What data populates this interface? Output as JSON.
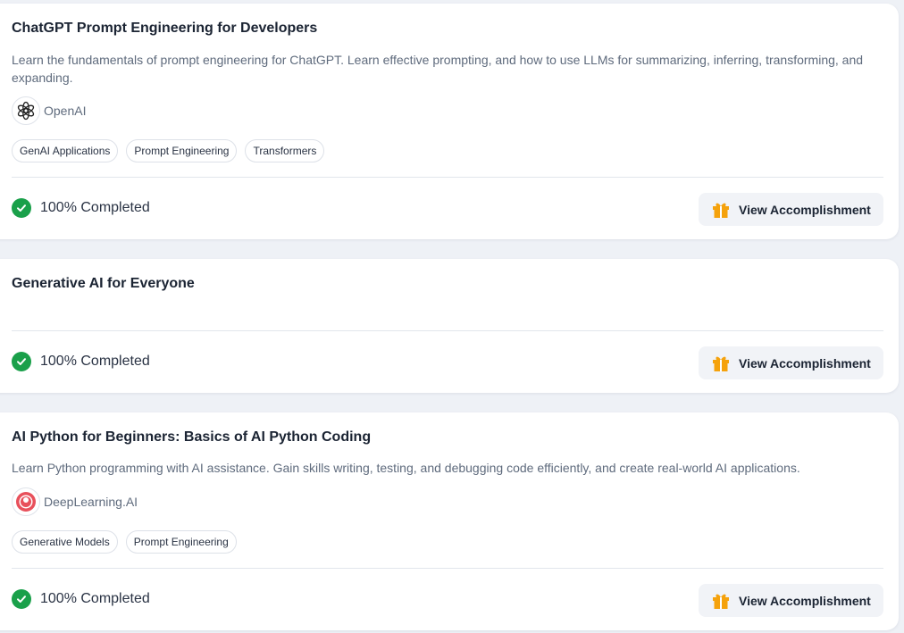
{
  "courses": [
    {
      "title": "ChatGPT Prompt Engineering for Developers",
      "description": "Learn the fundamentals of prompt engineering for ChatGPT. Learn effective prompting, and how to use LLMs for summarizing, inferring, transforming, and expanding.",
      "provider": "OpenAI",
      "provider_icon": "openai-logo-icon",
      "tags": [
        "GenAI Applications",
        "Prompt Engineering",
        "Transformers"
      ],
      "status": "100% Completed",
      "button_label": "View Accomplishment"
    },
    {
      "title": "Generative AI for Everyone",
      "status": "100% Completed",
      "button_label": "View Accomplishment"
    },
    {
      "title": "AI Python for Beginners: Basics of AI Python Coding",
      "description": "Learn Python programming with AI assistance. Gain skills writing, testing, and debugging code efficiently, and create real-world AI applications.",
      "provider": "DeepLearning.AI",
      "provider_icon": "deeplearning-ai-logo-icon",
      "tags": [
        "Generative Models",
        "Prompt Engineering"
      ],
      "status": "100% Completed",
      "button_label": "View Accomplishment"
    }
  ],
  "colors": {
    "complete_green": "#1aa04a",
    "gift_orange": "#f5a20c",
    "deeplearning_red": "#e8505b"
  }
}
